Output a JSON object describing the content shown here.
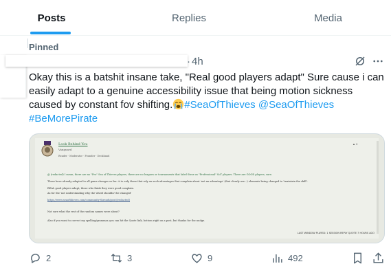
{
  "tabs": [
    {
      "label": "Posts",
      "active": true
    },
    {
      "label": "Replies",
      "active": false
    },
    {
      "label": "Media",
      "active": false
    }
  ],
  "pinned": {
    "label": "Pinned"
  },
  "post": {
    "time": "4h",
    "dot": "·",
    "text_main": "Okay this is a batshit insane take, \"Real good players adapt\" Sure cause i can easily adapt to a genuine accessibility issue that being motion sickness caused by constant fov shifting.",
    "hashtag1": "#SeaOfThieves",
    "mention": "@SeaOfThieves",
    "hashtag2": "#BeMorePirate",
    "emoji_icon": "crying-face-emoji"
  },
  "media": {
    "title": "Look Behind You",
    "rank": "Vanguard",
    "meta": "Reader · Moderator · Founder · Deckhand",
    "flag": "▲ 0",
    "lines": [
      "@ (redacted) I mean, there are no \"Pro\" Sea of Thieves players, there are no leagues or tournaments that label these as \"Professional\" SoT players. There are GOOD players, sure.",
      "Those have already adapted to all game changes so far...it is only those that rely on such advantages that complain about 'not an advantage' (that clearly are...) elements being changed to \"maintain the skill\".",
      "REAL good players adapt, those who think they were good complain.",
      "As for the 'not understanding why the wheel shouldn't be changed'",
      "https://www.seaofthieves.com/community-threads/post/(redacted)",
      "Not sure what the rest of the random names were about?",
      "Also if you want to correct my spelling/grammar, you can hit the Quote link, bottom right on a post, but thanks for the nudge."
    ],
    "footer": "LAST WINDOW PLAYED: 1 SESSION   REPLY   QUOTE   7 HOURS AGO"
  },
  "actions": {
    "replies": "2",
    "reposts": "3",
    "likes": "9",
    "views": "492"
  },
  "colors": {
    "accent": "#1d9bf0",
    "muted": "#536471",
    "text": "#0f1419"
  }
}
